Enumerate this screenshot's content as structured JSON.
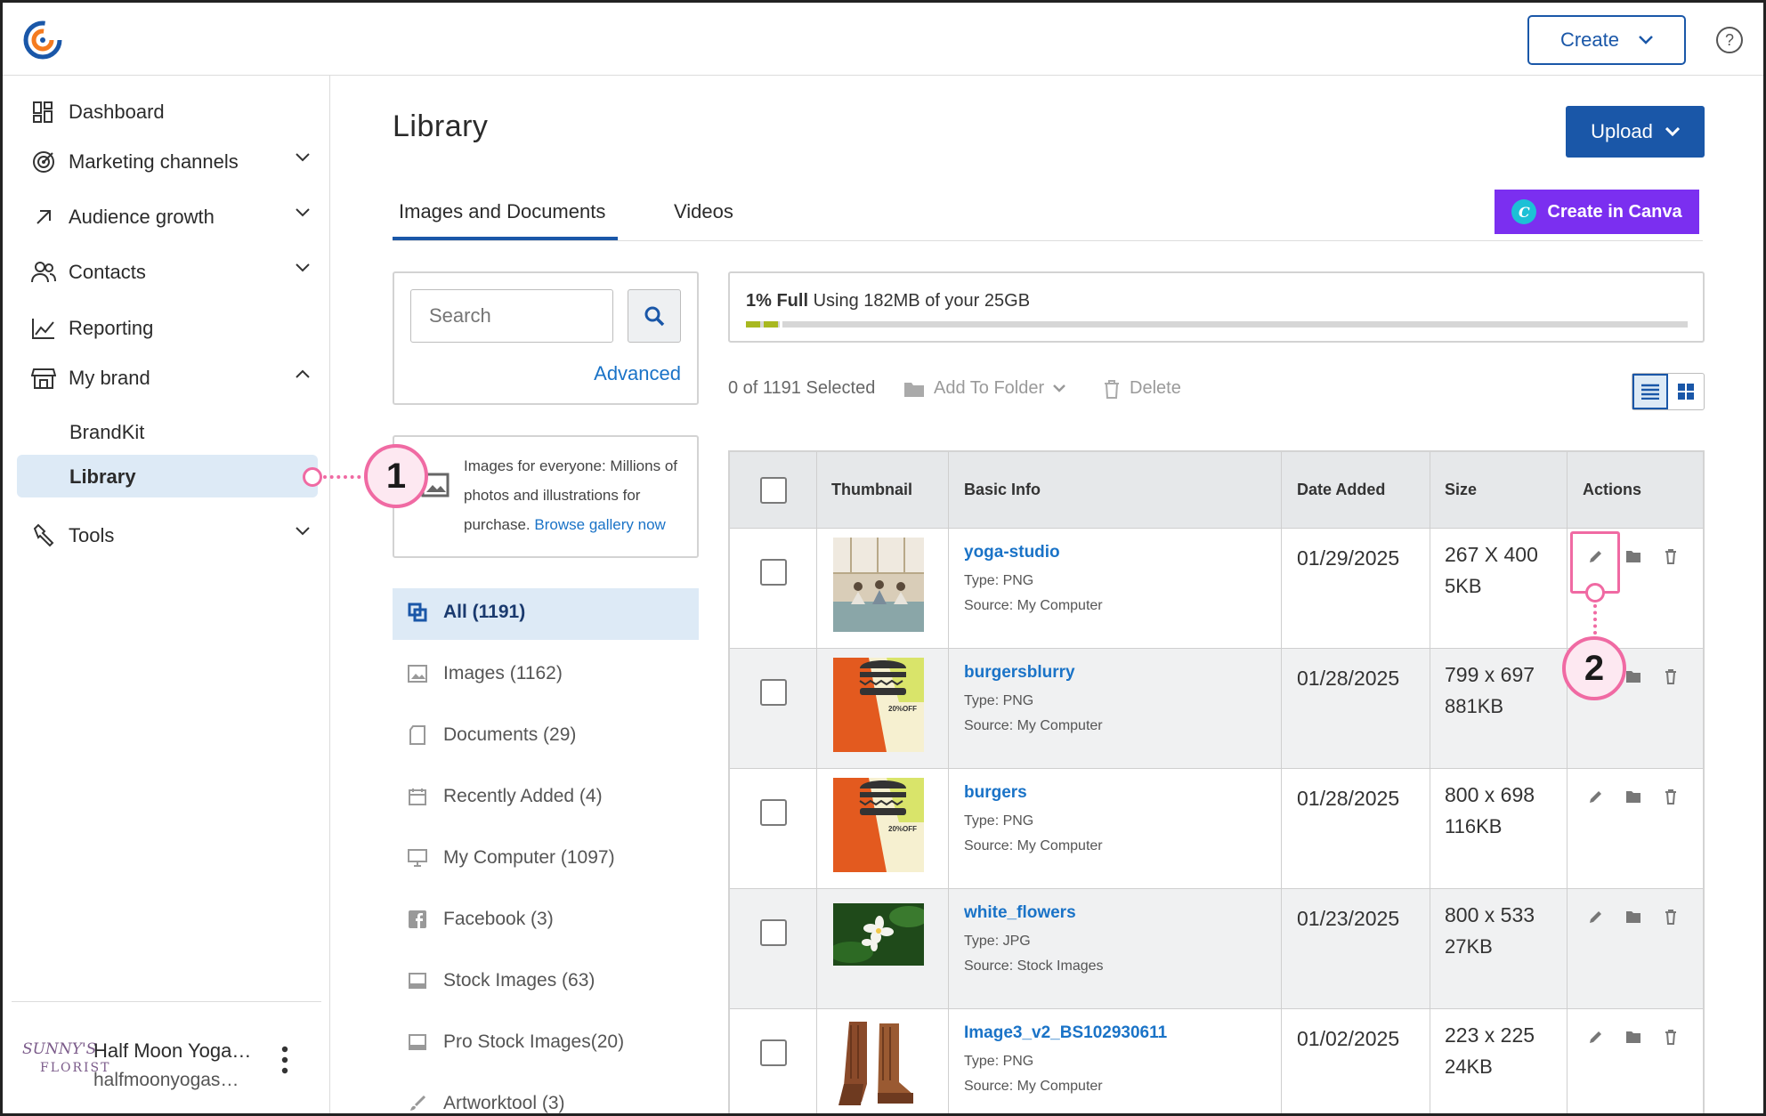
{
  "header": {
    "create_label": "Create",
    "help_icon": "question-circle-icon"
  },
  "sidebar": {
    "items": [
      {
        "label": "Dashboard",
        "icon": "dashboard-icon"
      },
      {
        "label": "Marketing channels",
        "icon": "target-icon"
      },
      {
        "label": "Audience growth",
        "icon": "arrow-up-right-icon"
      },
      {
        "label": "Contacts",
        "icon": "people-icon"
      },
      {
        "label": "Reporting",
        "icon": "chart-icon"
      },
      {
        "label": "My brand",
        "icon": "storefront-icon"
      },
      {
        "label": "Tools",
        "icon": "wrench-icon"
      }
    ],
    "sub_items": [
      "BrandKit",
      "Library"
    ],
    "active_sub": "Library",
    "account": {
      "logo_text_1": "SUNNY'S",
      "logo_text_2": "FLORIST",
      "name": "Half Moon Yoga…",
      "email": "halfmoonyogas…"
    }
  },
  "page": {
    "title": "Library",
    "upload_label": "Upload",
    "canva_label": "Create in Canva",
    "tabs": [
      "Images and Documents",
      "Videos"
    ],
    "active_tab": "Images and Documents"
  },
  "search": {
    "placeholder": "Search",
    "advanced_label": "Advanced"
  },
  "gallery": {
    "text": "Images for everyone: Millions of photos and illustrations for purchase.",
    "link": "Browse gallery now"
  },
  "folders": [
    {
      "label": "All (1191)",
      "icon": "all-items-icon",
      "active": true
    },
    {
      "label": "Images (1162)",
      "icon": "image-icon"
    },
    {
      "label": "Documents (29)",
      "icon": "document-icon"
    },
    {
      "label": "Recently Added (4)",
      "icon": "calendar-icon"
    },
    {
      "label": "My Computer (1097)",
      "icon": "monitor-icon"
    },
    {
      "label": "Facebook (3)",
      "icon": "facebook-icon"
    },
    {
      "label": "Stock Images (63)",
      "icon": "stock-image-icon"
    },
    {
      "label": "Pro Stock Images(20)",
      "icon": "pro-stock-icon"
    },
    {
      "label": "Artworktool (3)",
      "icon": "brush-icon"
    }
  ],
  "storage": {
    "percent_label": "1% Full",
    "usage_text": "Using 182MB of your 25GB",
    "percent": 1
  },
  "toolbar": {
    "selected_text": "0 of 1191 Selected",
    "add_to_folder": "Add To Folder",
    "delete": "Delete"
  },
  "table": {
    "headers": [
      "Thumbnail",
      "Basic Info",
      "Date Added",
      "Size",
      "Actions"
    ],
    "rows": [
      {
        "name": "yoga-studio",
        "type": "Type: PNG",
        "source": "Source: My Computer",
        "date": "01/29/2025",
        "dims": "267 X 400",
        "size": "5KB",
        "thumb": "yoga"
      },
      {
        "name": "burgersblurry",
        "type": "Type: PNG",
        "source": "Source: My Computer",
        "date": "01/28/2025",
        "dims": "799 x 697",
        "size": "881KB",
        "thumb": "burger"
      },
      {
        "name": "burgers",
        "type": "Type: PNG",
        "source": "Source: My Computer",
        "date": "01/28/2025",
        "dims": "800 x 698",
        "size": "116KB",
        "thumb": "burger"
      },
      {
        "name": "white_flowers",
        "type": "Type: JPG",
        "source": "Source: Stock Images",
        "date": "01/23/2025",
        "dims": "800 x 533",
        "size": "27KB",
        "thumb": "flowers"
      },
      {
        "name": "Image3_v2_BS102930611",
        "type": "Type: PNG",
        "source": "Source: My Computer",
        "date": "01/02/2025",
        "dims": "223 x 225",
        "size": "24KB",
        "thumb": "boots"
      }
    ],
    "thumb_label": "20%OFF"
  },
  "callouts": [
    "1",
    "2"
  ],
  "colors": {
    "brand_blue": "#1a57a8",
    "link_blue": "#1a73c7",
    "canva_purple": "#7b2ff0",
    "callout_pink": "#f06aa3",
    "storage_green": "#a8b820"
  }
}
